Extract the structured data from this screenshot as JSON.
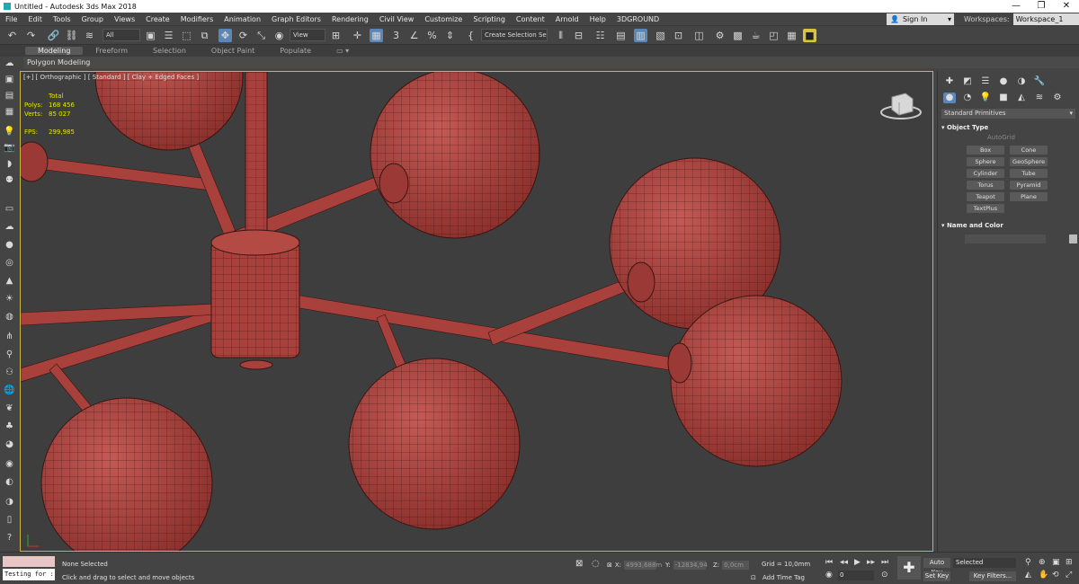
{
  "window": {
    "title": "Untitled - Autodesk 3ds Max 2018",
    "minimize": "—",
    "maximize": "❐",
    "close": "✕"
  },
  "menu": [
    "File",
    "Edit",
    "Tools",
    "Group",
    "Views",
    "Create",
    "Modifiers",
    "Animation",
    "Graph Editors",
    "Rendering",
    "Civil View",
    "Customize",
    "Scripting",
    "Content",
    "Arnold",
    "Help",
    "3DGROUND"
  ],
  "signin": "Sign In",
  "workspaces": {
    "label": "Workspaces:",
    "value": "Workspace_1"
  },
  "toolbar": {
    "filter": "All",
    "refcoord": "View",
    "selset": "Create Selection Se"
  },
  "ribbon": {
    "tabs": [
      "Modeling",
      "Freeform",
      "Selection",
      "Object Paint",
      "Populate"
    ],
    "active": "Modeling",
    "panel": "Polygon Modeling"
  },
  "viewport": {
    "label": "[+] [ Orthographic ] [ Standard ] [ Clay + Edged Faces ]",
    "stats": {
      "total": "Total",
      "polys_label": "Polys:",
      "polys": "168 456",
      "verts_label": "Verts:",
      "verts": "85 027",
      "fps_label": "FPS:",
      "fps": "299,985"
    },
    "model_color": "#a8403b",
    "wire_color": "#3a1512",
    "bg": "#3e3e3e"
  },
  "command_panel": {
    "category": "Standard Primitives",
    "object_type": "Object Type",
    "autogrid": "AutoGrid",
    "buttons": [
      "Box",
      "Cone",
      "Sphere",
      "GeoSphere",
      "Cylinder",
      "Tube",
      "Torus",
      "Pyramid",
      "Teapot",
      "Plane",
      "TextPlus"
    ],
    "name_and_color": "Name and Color"
  },
  "status": {
    "maxscript": "Testing for :",
    "selected": "None Selected",
    "prompt": "Click and drag to select and move objects",
    "x_label": "X:",
    "x": "4993,688m",
    "y_label": "Y:",
    "y": "-12834,94",
    "z_label": "Z:",
    "z": "0,0cm",
    "grid": "Grid = 10,0mm",
    "add_time_tag": "Add Time Tag",
    "frame": "0",
    "autokey": "Auto Key",
    "setkey": "Set Key",
    "selected_mode": "Selected",
    "key_filters": "Key Filters..."
  }
}
